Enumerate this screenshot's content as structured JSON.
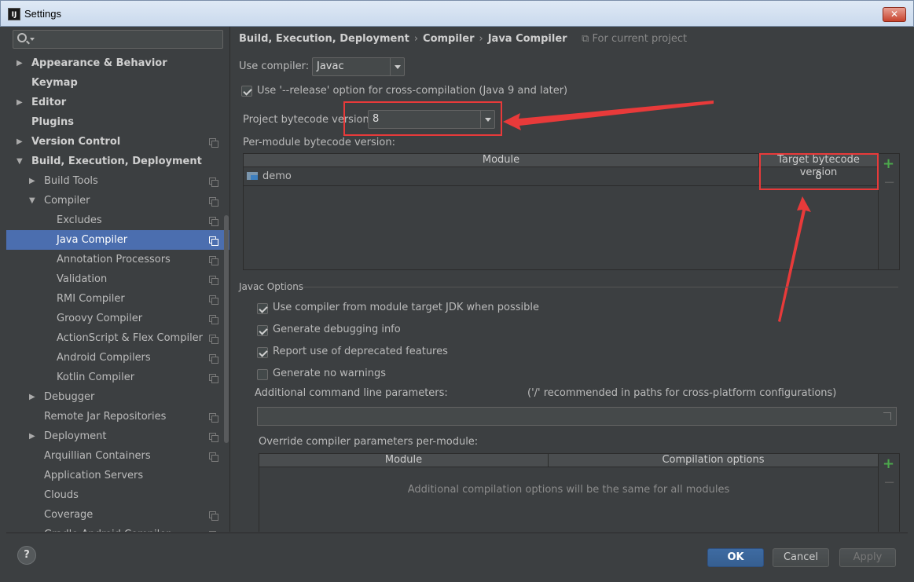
{
  "window": {
    "title": "Settings",
    "app_icon": "IJ"
  },
  "sidebar": {
    "search_placeholder": "",
    "items": [
      {
        "label": "Appearance & Behavior",
        "bold": true,
        "level": 0,
        "arrow": "collapsed",
        "project": false
      },
      {
        "label": "Keymap",
        "bold": true,
        "level": 0,
        "arrow": "none",
        "project": false
      },
      {
        "label": "Editor",
        "bold": true,
        "level": 0,
        "arrow": "collapsed",
        "project": false
      },
      {
        "label": "Plugins",
        "bold": true,
        "level": 0,
        "arrow": "none",
        "project": false
      },
      {
        "label": "Version Control",
        "bold": true,
        "level": 0,
        "arrow": "collapsed",
        "project": true
      },
      {
        "label": "Build, Execution, Deployment",
        "bold": true,
        "level": 0,
        "arrow": "expanded",
        "project": false
      },
      {
        "label": "Build Tools",
        "bold": false,
        "level": 1,
        "arrow": "collapsed",
        "project": true
      },
      {
        "label": "Compiler",
        "bold": false,
        "level": 1,
        "arrow": "expanded",
        "project": true
      },
      {
        "label": "Excludes",
        "bold": false,
        "level": 2,
        "arrow": "none",
        "project": true
      },
      {
        "label": "Java Compiler",
        "bold": false,
        "level": 2,
        "arrow": "none",
        "project": true,
        "selected": true
      },
      {
        "label": "Annotation Processors",
        "bold": false,
        "level": 2,
        "arrow": "none",
        "project": true
      },
      {
        "label": "Validation",
        "bold": false,
        "level": 2,
        "arrow": "none",
        "project": true
      },
      {
        "label": "RMI Compiler",
        "bold": false,
        "level": 2,
        "arrow": "none",
        "project": true
      },
      {
        "label": "Groovy Compiler",
        "bold": false,
        "level": 2,
        "arrow": "none",
        "project": true
      },
      {
        "label": "ActionScript & Flex Compiler",
        "bold": false,
        "level": 2,
        "arrow": "none",
        "project": true
      },
      {
        "label": "Android Compilers",
        "bold": false,
        "level": 2,
        "arrow": "none",
        "project": true
      },
      {
        "label": "Kotlin Compiler",
        "bold": false,
        "level": 2,
        "arrow": "none",
        "project": true
      },
      {
        "label": "Debugger",
        "bold": false,
        "level": 1,
        "arrow": "collapsed",
        "project": false
      },
      {
        "label": "Remote Jar Repositories",
        "bold": false,
        "level": 1,
        "arrow": "none",
        "project": true
      },
      {
        "label": "Deployment",
        "bold": false,
        "level": 1,
        "arrow": "collapsed",
        "project": true
      },
      {
        "label": "Arquillian Containers",
        "bold": false,
        "level": 1,
        "arrow": "none",
        "project": true
      },
      {
        "label": "Application Servers",
        "bold": false,
        "level": 1,
        "arrow": "none",
        "project": false
      },
      {
        "label": "Clouds",
        "bold": false,
        "level": 1,
        "arrow": "none",
        "project": false
      },
      {
        "label": "Coverage",
        "bold": false,
        "level": 1,
        "arrow": "none",
        "project": true
      },
      {
        "label": "Gradle-Android Compiler",
        "bold": false,
        "level": 1,
        "arrow": "none",
        "project": true
      }
    ]
  },
  "breadcrumb": {
    "parts": [
      "Build, Execution, Deployment",
      "Compiler",
      "Java Compiler"
    ],
    "separator": "›",
    "scope": "For current project"
  },
  "compiler": {
    "use_compiler_label": "Use compiler:",
    "use_compiler_value": "Javac",
    "release_option_label": "Use '--release' option for cross-compilation (Java 9 and later)",
    "release_option_checked": true,
    "project_bytecode_label": "Project bytecode version:",
    "project_bytecode_value": "8",
    "per_module_label": "Per-module bytecode version:",
    "module_table": {
      "headers": [
        "Module",
        "Target bytecode version"
      ],
      "rows": [
        {
          "module": "demo",
          "target": "8"
        }
      ]
    }
  },
  "javac": {
    "section_label": "Javac Options",
    "options": [
      {
        "label": "Use compiler from module target JDK when possible",
        "checked": true
      },
      {
        "label": "Generate debugging info",
        "checked": true
      },
      {
        "label": "Report use of deprecated features",
        "checked": true
      },
      {
        "label": "Generate no warnings",
        "checked": false
      }
    ],
    "additional_params_label": "Additional command line parameters:",
    "additional_params_hint": "('/' recommended in paths for cross-platform configurations)",
    "additional_params_value": "",
    "override_label": "Override compiler parameters per-module:",
    "override_table": {
      "headers": [
        "Module",
        "Compilation options"
      ],
      "empty_text": "Additional compilation options will be the same for all modules"
    }
  },
  "footer": {
    "help": "?",
    "ok": "OK",
    "cancel": "Cancel",
    "apply": "Apply"
  },
  "icons": {
    "plus": "+",
    "minus": "−"
  },
  "colors": {
    "selection": "#4b6eaf",
    "annotation": "#e83a3a",
    "add_green": "#4ca84c"
  }
}
